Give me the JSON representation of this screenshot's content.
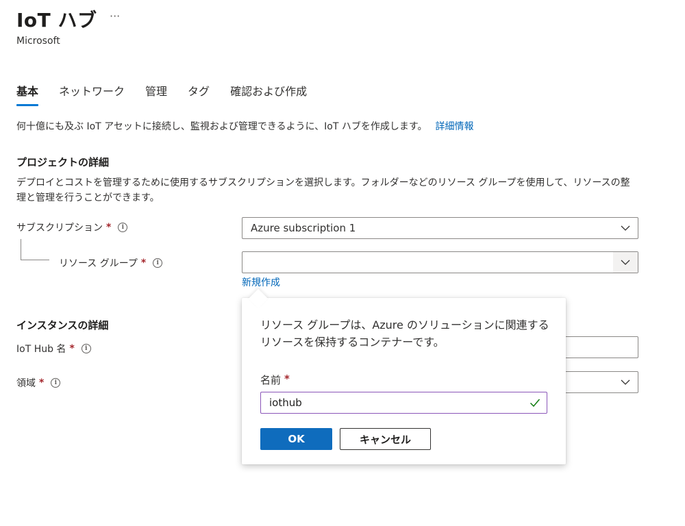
{
  "header": {
    "title": "IoT ハブ",
    "more": "···",
    "publisher": "Microsoft"
  },
  "tabs": [
    {
      "label": "基本",
      "active": true
    },
    {
      "label": "ネットワーク",
      "active": false
    },
    {
      "label": "管理",
      "active": false
    },
    {
      "label": "タグ",
      "active": false
    },
    {
      "label": "確認および作成",
      "active": false
    }
  ],
  "intro": {
    "text": "何十億にも及ぶ IoT アセットに接続し、監視および管理できるように、IoT ハブを作成します。",
    "link": "詳細情報"
  },
  "project": {
    "title": "プロジェクトの詳細",
    "description": "デプロイとコストを管理するために使用するサブスクリプションを選択します。フォルダーなどのリソース グループを使用して、リソースの整理と管理を行うことができます。",
    "subscription_label": "サブスクリプション",
    "subscription_value": "Azure subscription 1",
    "resource_group_label": "リソース グループ",
    "resource_group_value": "",
    "new_link": "新規作成"
  },
  "instance": {
    "title": "インスタンスの詳細",
    "hub_name_label": "IoT Hub 名",
    "region_label": "領域"
  },
  "required_mark": "*",
  "info_glyph": "i",
  "callout": {
    "text": "リソース グループは、Azure のソリューションに関連するリソースを保持するコンテナーです。",
    "name_label": "名前",
    "name_value": "iothub",
    "ok_label": "OK",
    "cancel_label": "キャンセル"
  },
  "colors": {
    "accent": "#0078d4",
    "link": "#0066b8",
    "required": "#a4262c",
    "valid": "#107c10",
    "focus_border": "#8a55b8"
  }
}
